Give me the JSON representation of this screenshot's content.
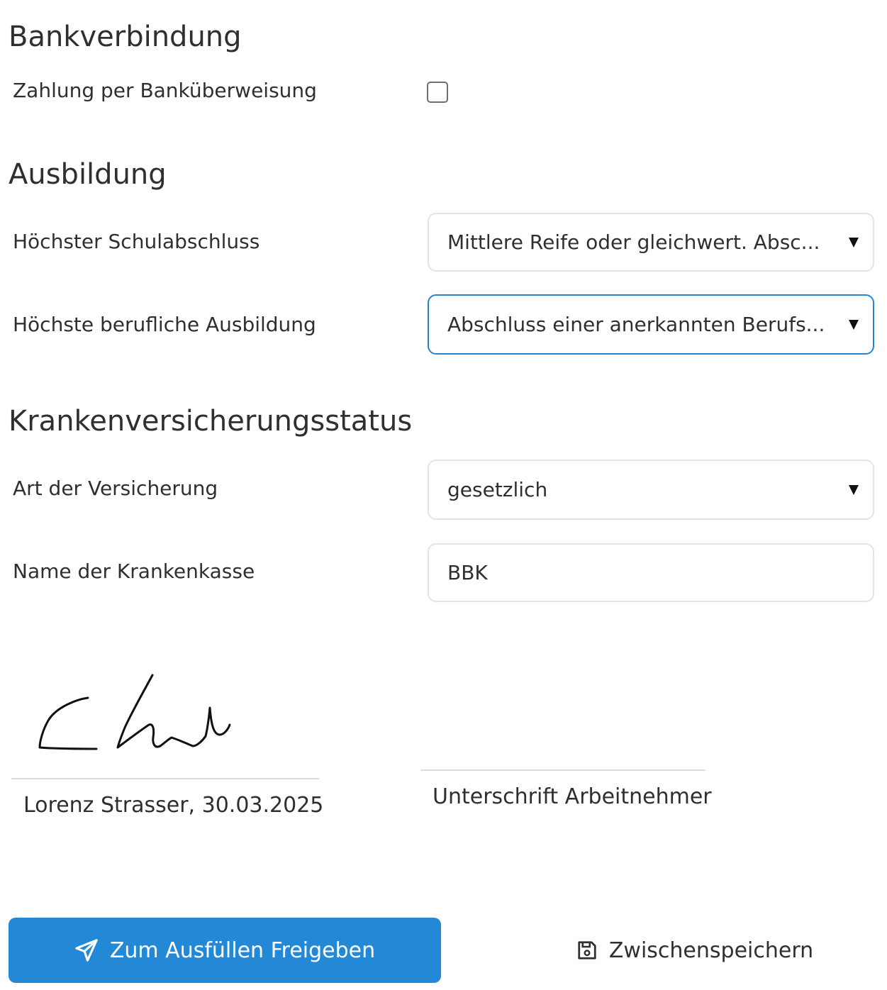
{
  "sections": {
    "bank": {
      "title": "Bankverbindung",
      "transfer_label": "Zahlung per Banküberweisung",
      "transfer_checked": false
    },
    "education": {
      "title": "Ausbildung",
      "school_label": "Höchster Schulabschluss",
      "school_value": "Mittlere Reife oder gleichwert. Absc...",
      "vocational_label": "Höchste berufliche Ausbildung",
      "vocational_value": "Abschluss einer anerkannten Berufs..."
    },
    "insurance": {
      "title": "Krankenversicherungsstatus",
      "type_label": "Art der Versicherung",
      "type_value": "gesetzlich",
      "fund_label": "Name der Krankenkasse",
      "fund_value": "BBK"
    }
  },
  "signatures": {
    "employer_caption": "Lorenz Strasser, 30.03.2025",
    "employee_caption": "Unterschrift Arbeitnehmer"
  },
  "actions": {
    "release_label": "Zum Ausfüllen Freigeben",
    "release_icon": "paper-plane-icon",
    "save_label": "Zwischenspeichern",
    "save_icon": "floppy-disk-icon"
  },
  "colors": {
    "accent": "#2388d5",
    "focus_border": "#2684cf"
  }
}
